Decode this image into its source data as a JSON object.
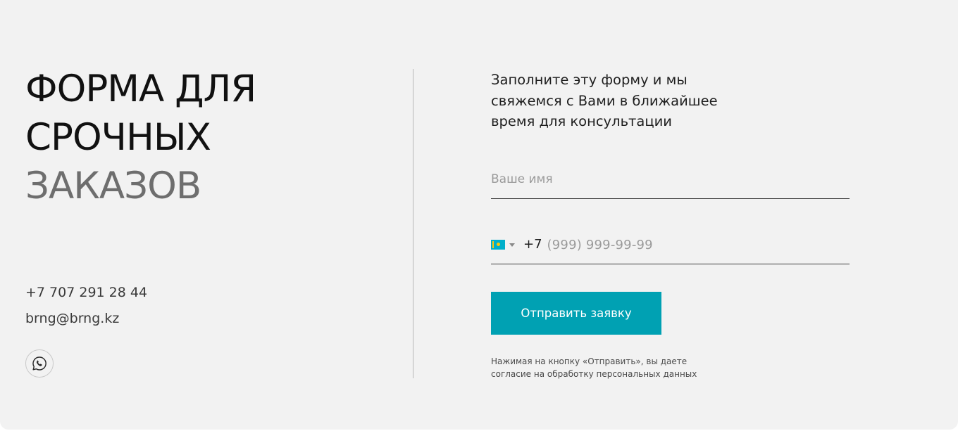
{
  "heading": {
    "line1": "ФОРМА ДЛЯ",
    "line2": "СРОЧНЫХ",
    "line3": "ЗАКАЗОВ"
  },
  "contacts": {
    "phone": "+7 707 291 28 44",
    "email": "brng@brng.kz",
    "messenger_icon": "whatsapp-icon"
  },
  "form": {
    "intro": "Заполните эту форму и мы свяжемся с Вами в ближайшее время для консультации",
    "name_field": {
      "value": "",
      "placeholder": "Ваше имя"
    },
    "phone_field": {
      "country_icon": "kazakhstan-flag-icon",
      "prefix": "+7",
      "value": "",
      "placeholder": "(999) 999-99-99"
    },
    "submit_label": "Отправить заявку",
    "consent_text": "Нажимая на кнопку «Отправить», вы даете согласие на обработку персональных данных"
  },
  "colors": {
    "background": "#f2f2f2",
    "accent": "#00a1b3",
    "heading_dark": "#111111",
    "heading_muted": "#6e6e6e"
  }
}
